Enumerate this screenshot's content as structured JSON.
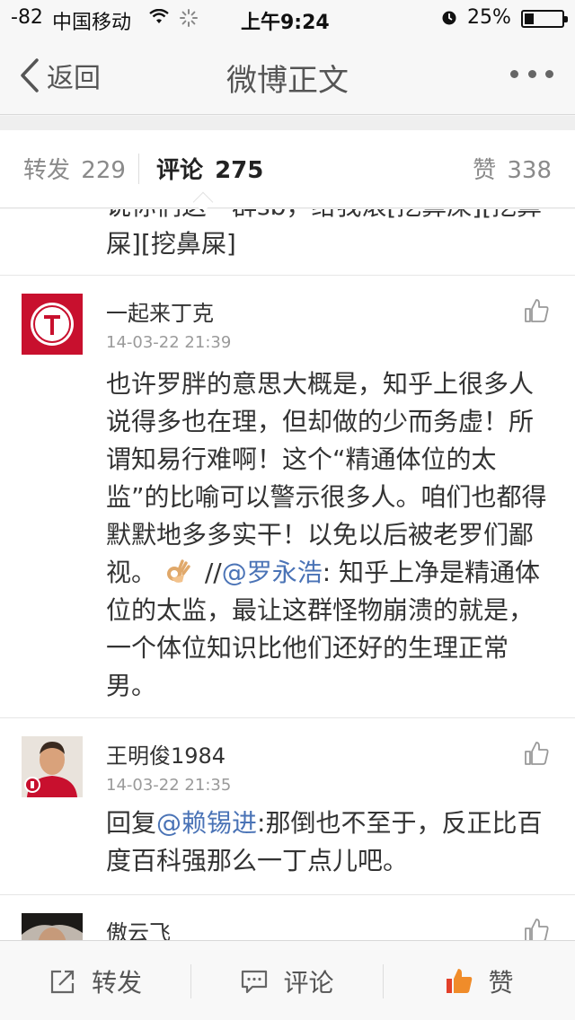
{
  "status_bar": {
    "signal": "-82",
    "carrier": "中国移动",
    "time": "上午9:24",
    "battery": "25%",
    "battery_level": 0.25
  },
  "nav": {
    "back_label": "返回",
    "title": "微博正文"
  },
  "tabs": {
    "repost_label": "转发",
    "repost_count": "229",
    "comment_label": "评论",
    "comment_count": "275",
    "like_label": "赞",
    "like_count": "338"
  },
  "comments": [
    {
      "partial_text": "说你们这一群sb，给我滚[挖鼻屎][挖鼻屎][挖鼻屎]"
    },
    {
      "name": "一起来丁克",
      "time": "14-03-22 21:39",
      "text_part1": "也许罗胖的意思大概是，知乎上很多人说得多也在理，但却做的少而务虚！所谓知易行难啊！这个“精通体位的太监”的比喻可以警示很多人。咱们也都得默默地多多实干！以免以后被老罗们鄙视。",
      "prefix": "//",
      "mention": "@罗永浩",
      "text_part2": ": 知乎上净是精通体位的太监，最让这群怪物崩溃的就是，一个体位知识比他们还好的生理正常男。"
    },
    {
      "name": "王明俊1984",
      "time": "14-03-22 21:35",
      "reply_prefix": "回复",
      "mention": "@赖锡进",
      "text": ":那倒也不至于，反正比百度百科强那么一丁点儿吧。"
    },
    {
      "name": "傲云飞"
    }
  ],
  "toolbar": {
    "repost": "转发",
    "comment": "评论",
    "like": "赞"
  },
  "colors": {
    "link": "#4a73b6",
    "like_orange": "#f08c2a",
    "avatar_red": "#c8102e"
  }
}
